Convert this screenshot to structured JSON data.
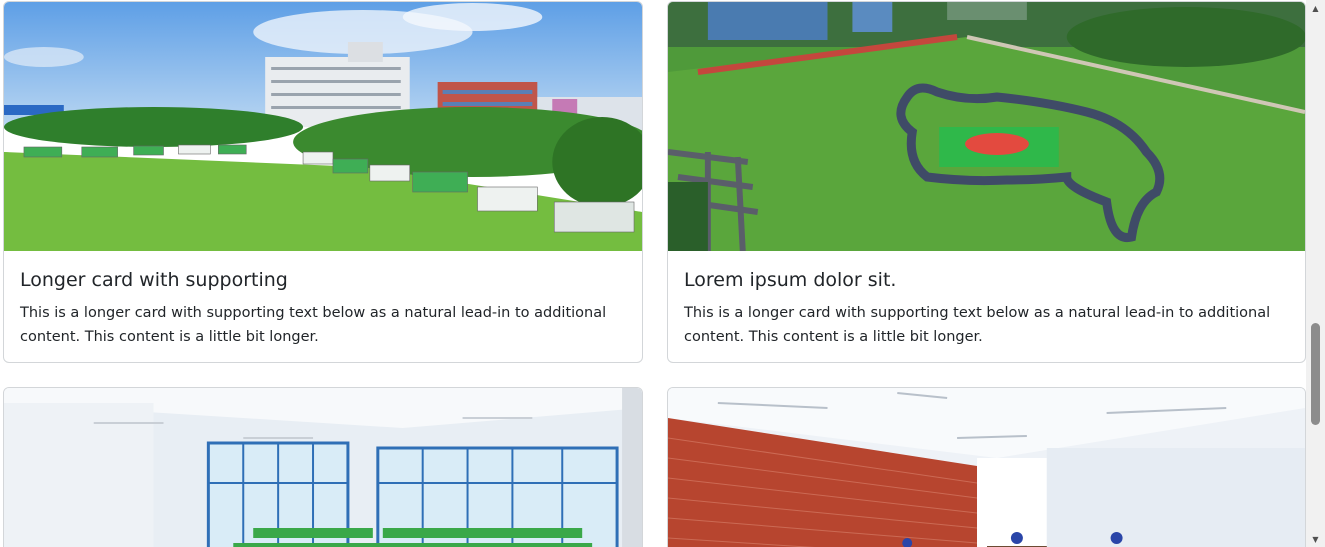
{
  "cards": [
    {
      "title": "Longer card with supporting",
      "text": "This is a longer card with supporting text below as a natural lead-in to additional content. This content is a little bit longer.",
      "image_icon": "campus-buses-photo-icon"
    },
    {
      "title": "Lorem ipsum dolor sit.",
      "text": "This is a longer card with supporting text below as a natural lead-in to additional content. This content is a little bit longer.",
      "image_icon": "aerial-field-map-photo-icon"
    },
    {
      "title": "",
      "text": "",
      "image_icon": "classroom-windows-photo-icon"
    },
    {
      "title": "",
      "text": "",
      "image_icon": "classroom-brick-wall-photo-icon"
    }
  ],
  "scrollbar": {
    "up_arrow": "▲",
    "down_arrow": "▼"
  }
}
